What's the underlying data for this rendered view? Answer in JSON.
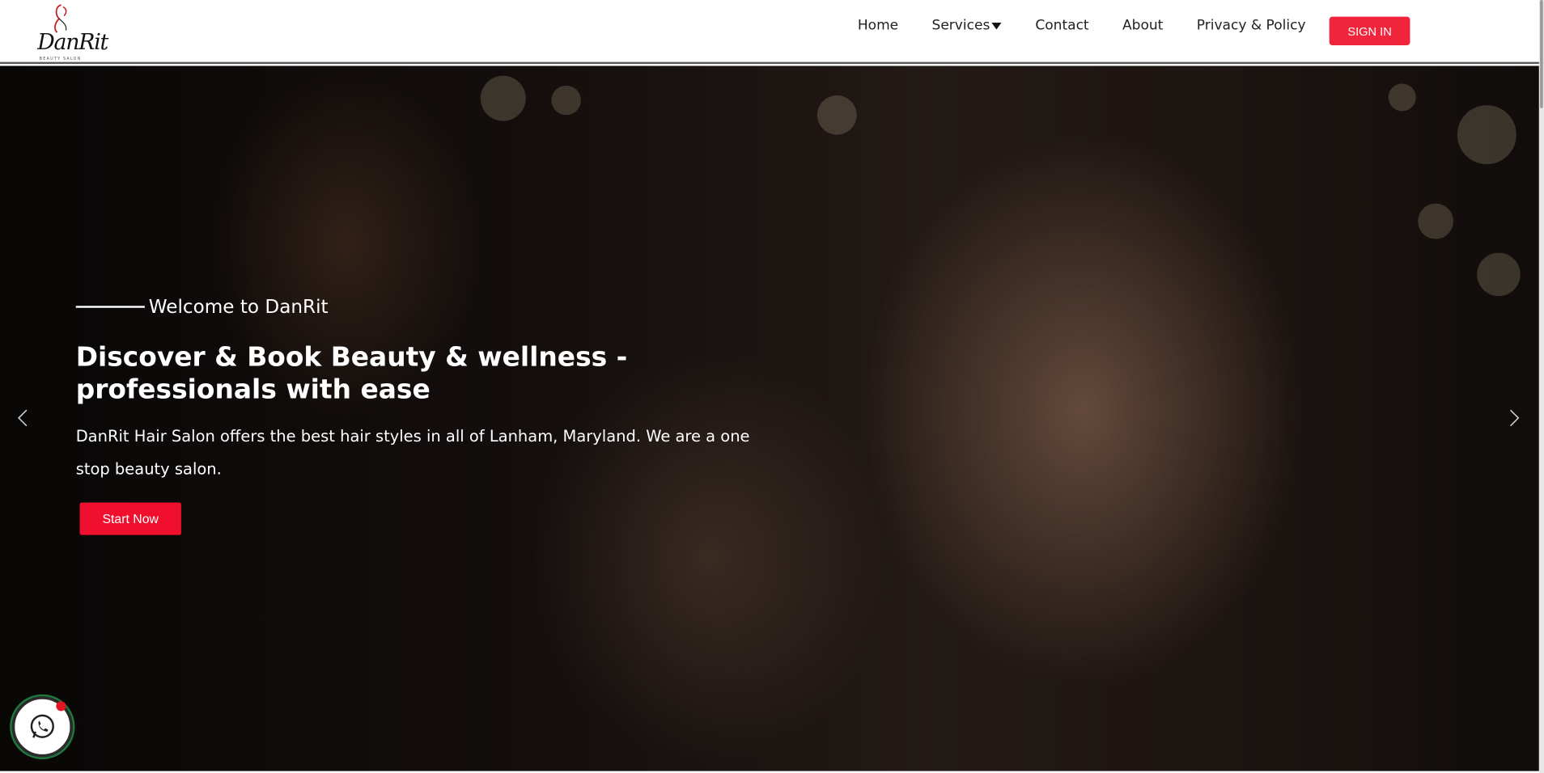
{
  "header": {
    "logo_text": "DanRit",
    "logo_tagline": "BEAUTY SALON",
    "nav": {
      "home": "Home",
      "services": "Services",
      "contact": "Contact",
      "about": "About",
      "privacy": "Privacy & Policy"
    },
    "signin_label": "SIGN IN"
  },
  "hero": {
    "welcome": "Welcome to DanRit",
    "title": "Discover & Book Beauty & wellness - professionals with ease",
    "description": "DanRit Hair Salon offers the best hair styles in all of Lanham, Maryland. We are a one stop beauty salon.",
    "cta_label": "Start Now"
  },
  "colors": {
    "accent": "#f0243a",
    "cta": "#f0102e",
    "whatsapp_dot": "#e4161f"
  },
  "icons": {
    "prev": "chevron-left-icon",
    "next": "chevron-right-icon",
    "whatsapp": "whatsapp-icon",
    "services_dropdown": "caret-down-icon"
  }
}
